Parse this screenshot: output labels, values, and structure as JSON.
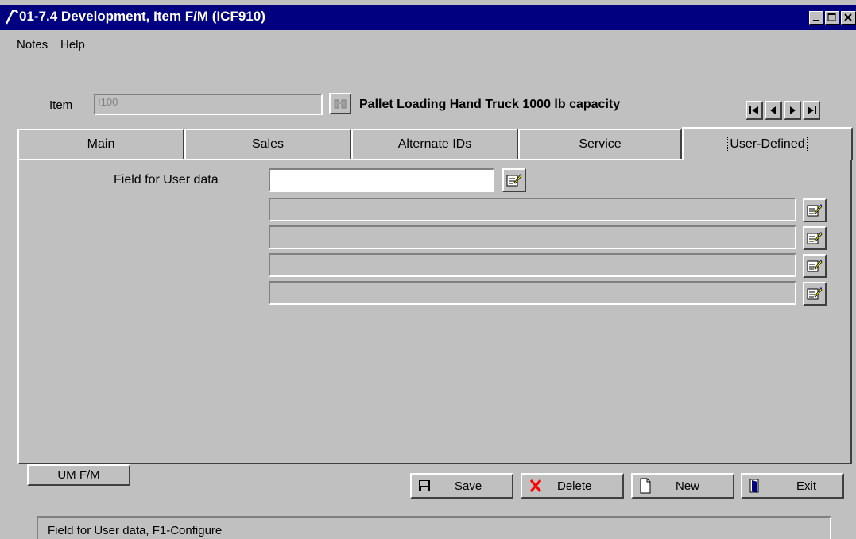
{
  "window": {
    "title": "01-7.4 Development, Item F/M (ICF910)"
  },
  "menu": {
    "items": [
      {
        "label": "Notes"
      },
      {
        "label": "Help"
      }
    ]
  },
  "item": {
    "label": "Item",
    "value": "I100",
    "description": "Pallet Loading Hand Truck 1000 lb capacity",
    "search_icon": "binoculars-icon"
  },
  "record_nav": {
    "icons": [
      "first-record-icon",
      "previous-record-icon",
      "next-record-icon",
      "last-record-icon"
    ]
  },
  "tabs": [
    {
      "label": "Main",
      "active": false
    },
    {
      "label": "Sales",
      "active": false
    },
    {
      "label": "Alternate IDs",
      "active": false
    },
    {
      "label": "Service",
      "active": false
    },
    {
      "label": "User-Defined",
      "active": true
    }
  ],
  "user_defined": {
    "field_label": "Field for User data",
    "field_value": "",
    "extra_fields": [
      "",
      "",
      "",
      ""
    ],
    "edit_icon": "edit-notes-icon"
  },
  "buttons": {
    "um_fm": "UM F/M",
    "save": "Save",
    "delete": "Delete",
    "new": "New",
    "exit": "Exit"
  },
  "status": {
    "text": "Field for User data, F1-Configure"
  },
  "colors": {
    "titlebar": "#000080",
    "face": "#c0c0c0",
    "delete_icon": "#ff0000"
  }
}
